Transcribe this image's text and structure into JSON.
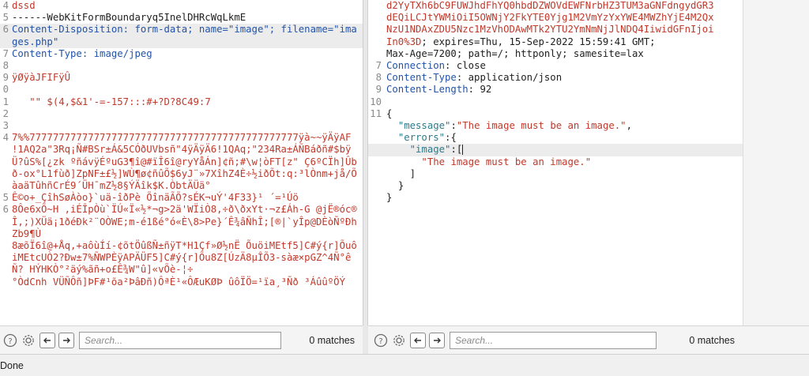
{
  "left": {
    "lines": [
      {
        "n": "4",
        "t": "dssd",
        "c": "c-red"
      },
      {
        "n": "5",
        "t": "------WebKitFormBoundaryq5InelDHRcWqLkmE",
        "c": "c-black"
      },
      {
        "n": "6",
        "t": "Content-Disposition: form-data; name=\"image\"; filename=\"images.php\"",
        "c": "c-blue",
        "hl": true
      },
      {
        "n": "7",
        "t": "Content-Type: image/jpeg",
        "c": "c-blue"
      },
      {
        "n": "8",
        "t": "",
        "c": "c-black"
      },
      {
        "n": "9",
        "t": "ÿØÿàJFIFÿÛ",
        "c": "c-red"
      },
      {
        "n": "0",
        "t": "",
        "c": "c-black"
      },
      {
        "n": "1",
        "t": "   \"\" $(4,$&1'-=-157:::#+?D?8C49:7",
        "c": "c-red"
      },
      {
        "n": "2",
        "t": "",
        "c": "c-black"
      },
      {
        "n": "3",
        "t": "",
        "c": "c-black"
      },
      {
        "n": "4",
        "t": "7%%7777777777777777777777777777777777777777777777ÿà~~ÿÄÿAF    !1AQ2a\"3Rq¡Ñ#BSr±Á&5CÓðUVbsñ\"4ÿÄÿÄ6!1QAq;\"234Ra±ÁÑBáðñ#$bÿÜ?ûS%[¿zk ºñávÿÉºuG3¶î@#ïÎ6î@ryYåÁn]¢ñ;#\\w¦òFT[z\" Ç6ºCÏh]Ûbð-ox°L1fùð]ZpNF±£½]WÙ¶ø¢ñûÕ$6yJ¨»7XîhZ4È÷½iðÕt:q:³lÒnm+jå/ÕàaäTûhñCrÉ9´ÜH¯mZ½8§ÝÄîk$K.ÒbtÄÜä°",
        "c": "c-red"
      },
      {
        "n": "5",
        "t": "Ê©o+_ÇîhSøÀòo}`uä-îðPè ÕînäÃÕ?sÉK¬uÝ'4F33}¹ ´=¹Úö",
        "c": "c-red"
      },
      {
        "n": "6",
        "t": "8Ôe6xÕ~H ,iÉÎpÒù`ÏÚ«Ï«½*¬g>2ä'WÏiÒ8,÷ð\\ðxYt·¬z£Áh-G @jË®óc®Î,;)XÜä¡1ðéÐk²¨OÒWE;m-é1ßé°ó«È\\8>Pe}´Ê¾âÑhÎ;[®|`yÎp@DÈòÑºÐhZb9¶Ù",
        "c": "c-red"
      },
      {
        "n": "",
        "t": "8æõÏ6î@+Åq,+aôùÍí-¢õtÖûßÑ±ñÿT*H1Çf»Ø½nË ÕuöiMEtf5]C#ý{r]ÕuôiMEtcUÒ2?Ðw±7%ÑWPÈÿAPÄÜF5]C#ý{r]Õu8Z[ÚzÄ8µÎÕ3-sàæ×pGZ^4Ñ°êÑ? HÝHKÒ°²äý%ãñ+o£Ê¾W\"û]«vÕè-¦÷",
        "c": "c-red"
      },
      {
        "n": "",
        "t": "°ÒdCnh VÜÑÔñ]ÞF#¹õa²ÞâÐñ)ÔªÈ¹«ÔÆuKØÞ ûôÏÖ=¹ïa¸³Ñð ³Áû­ûºÖÝ",
        "c": "c-red"
      }
    ]
  },
  "right": {
    "lines": [
      {
        "n": "",
        "t": "d2YyTXh6bC9FUWJhdFhYQ0hbdDZWOVdEWFNrbHZ3TUM3aGNFdngydGR3",
        "c": "c-red"
      },
      {
        "n": "",
        "t": "dEQiLCJtYWMiOiI5OWNjY2FkYTE0Yjg1M2VmYzYxYWE4MWZhYjE4M2Qx",
        "c": "c-red"
      },
      {
        "n": "",
        "t": "NzU1NDAxZDU5Nzc1MzVhODAwMTk2YTU2YmNmNjJlNDQ4IiwidGFnIjoi",
        "c": "c-red"
      },
      {
        "n": "",
        "t": "In0%3D; expires=Thu, 15-Sep-2022 15:59:41 GMT;",
        "c": "c-red",
        "mixed": true
      },
      {
        "n": "",
        "t": "Max-Age=7200; path=/; httponly; samesite=lax",
        "c": "c-black"
      },
      {
        "n": "7",
        "t": "Connection: close",
        "c": "c-blue",
        "hdr": [
          "Connection",
          ": close"
        ]
      },
      {
        "n": "8",
        "t": "Content-Type: application/json",
        "c": "c-blue",
        "hdr": [
          "Content-Type",
          ": application/json"
        ]
      },
      {
        "n": "9",
        "t": "Content-Length: 92",
        "c": "c-blue",
        "hdr": [
          "Content-Length",
          ": 92"
        ]
      },
      {
        "n": "10",
        "t": "",
        "c": "c-black"
      },
      {
        "n": "11",
        "t": "{",
        "c": "c-black"
      },
      {
        "n": "",
        "t": "  \"message\":\"The image must be an image.\",",
        "c": "c-black",
        "json": [
          "  ",
          "\"message\"",
          ":",
          "\"The image must be an image.\"",
          ","
        ]
      },
      {
        "n": "",
        "t": "  \"errors\":{",
        "c": "c-black",
        "json": [
          "  ",
          "\"errors\"",
          ":{",
          "",
          ""
        ]
      },
      {
        "n": "",
        "t": "    \"image\":[",
        "c": "c-black",
        "hl": true,
        "json": [
          "    ",
          "\"image\"",
          ":[",
          "",
          ""
        ]
      },
      {
        "n": "",
        "t": "      \"The image must be an image.\"",
        "c": "c-str"
      },
      {
        "n": "",
        "t": "    ]",
        "c": "c-black"
      },
      {
        "n": "",
        "t": "  }",
        "c": "c-black"
      },
      {
        "n": "",
        "t": "}",
        "c": "c-black"
      }
    ]
  },
  "left_toolbar": {
    "search_placeholder": "Search...",
    "matches": "0 matches"
  },
  "right_toolbar": {
    "search_placeholder": "Search...",
    "matches": "0 matches"
  },
  "status": {
    "text": "Done"
  },
  "icons": {
    "help": "help-icon",
    "settings": "settings-gear-icon",
    "prev": "arrow-left-icon",
    "next": "arrow-right-icon"
  },
  "colors": {
    "red": "#c0392b",
    "blue": "#2253a8",
    "teal": "#2b7a8a",
    "gray": "#8a8a8a"
  }
}
